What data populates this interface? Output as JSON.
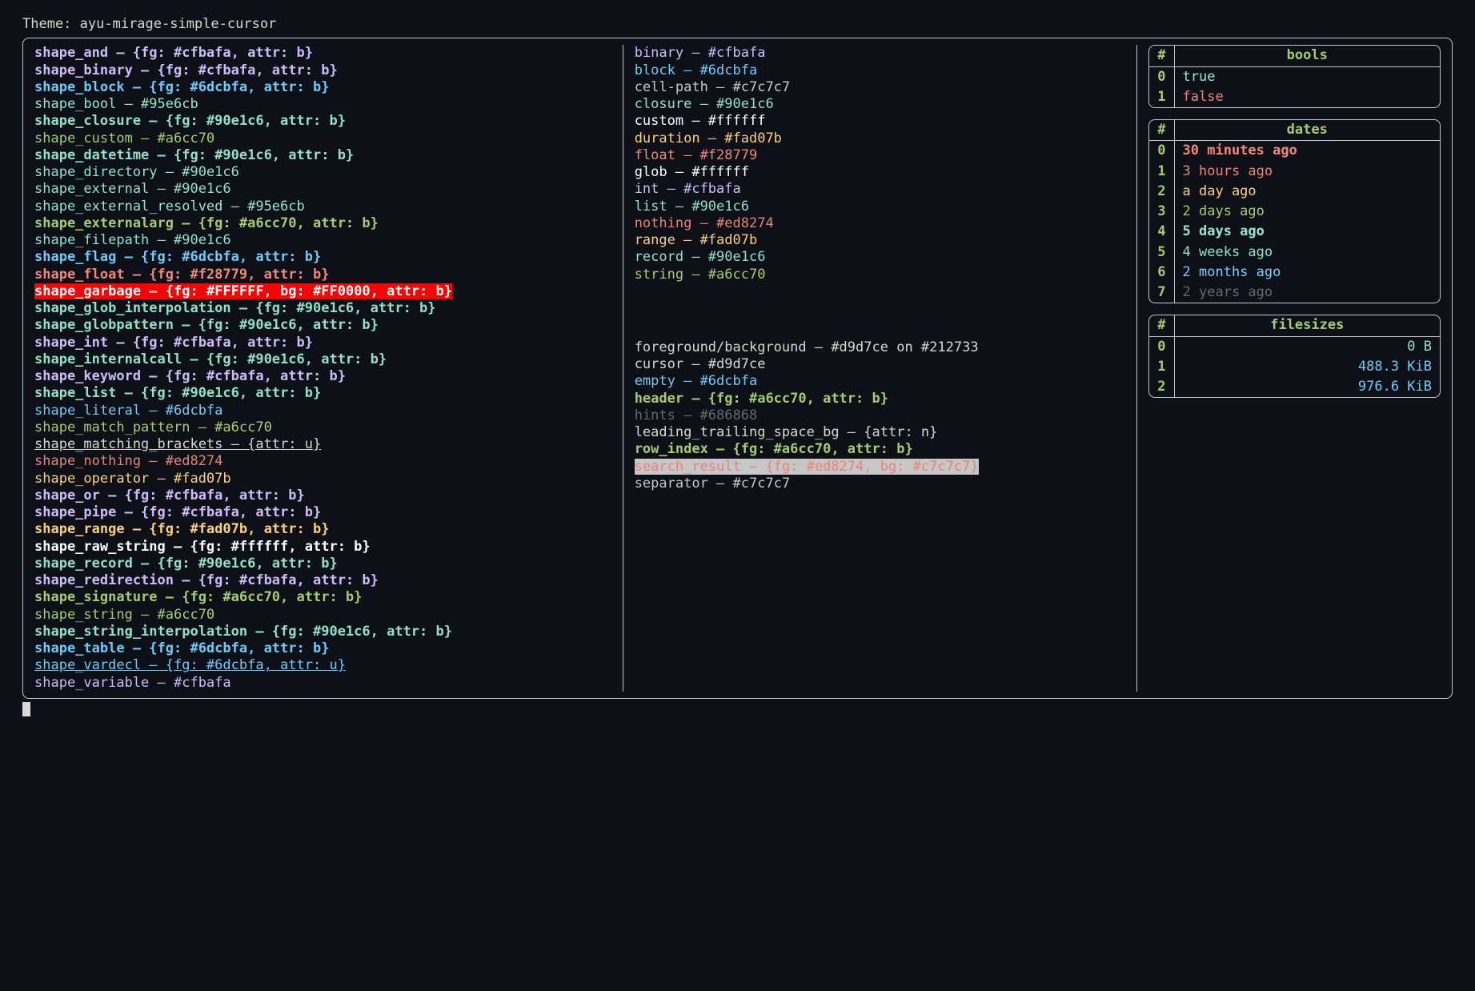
{
  "header": {
    "label": "Theme: ",
    "value": "ayu-mirage-simple-cursor"
  },
  "palette": {
    "fg": "#d9d7ce",
    "bg": "#212733",
    "cfbafa": "#cfbafa",
    "6dcbfa": "#6dcbfa",
    "95e6cb": "#95e6cb",
    "90e1c6": "#90e1c6",
    "a6cc70": "#a6cc70",
    "f28779": "#f28779",
    "fad07b": "#fad07b",
    "ed8274": "#ed8274",
    "c7c7c7": "#c7c7c7",
    "686868": "#686868",
    "ffffff": "#ffffff",
    "73d0ff": "#73d0ff"
  },
  "shapes": [
    {
      "name": "shape_and",
      "fg": "cfbafa",
      "bold": true,
      "text": "{fg: #cfbafa, attr: b}"
    },
    {
      "name": "shape_binary",
      "fg": "cfbafa",
      "bold": true,
      "text": "{fg: #cfbafa, attr: b}"
    },
    {
      "name": "shape_block",
      "fg": "6dcbfa",
      "bold": true,
      "text": "{fg: #6dcbfa, attr: b}"
    },
    {
      "name": "shape_bool",
      "fg": "95e6cb",
      "text": "#95e6cb"
    },
    {
      "name": "shape_closure",
      "fg": "90e1c6",
      "bold": true,
      "text": "{fg: #90e1c6, attr: b}"
    },
    {
      "name": "shape_custom",
      "fg": "a6cc70",
      "text": "#a6cc70"
    },
    {
      "name": "shape_datetime",
      "fg": "90e1c6",
      "bold": true,
      "text": "{fg: #90e1c6, attr: b}"
    },
    {
      "name": "shape_directory",
      "fg": "90e1c6",
      "text": "#90e1c6"
    },
    {
      "name": "shape_external",
      "fg": "90e1c6",
      "text": "#90e1c6"
    },
    {
      "name": "shape_external_resolved",
      "fg": "95e6cb",
      "text": "#95e6cb"
    },
    {
      "name": "shape_externalarg",
      "fg": "a6cc70",
      "bold": true,
      "text": "{fg: #a6cc70, attr: b}"
    },
    {
      "name": "shape_filepath",
      "fg": "90e1c6",
      "text": "#90e1c6"
    },
    {
      "name": "shape_flag",
      "fg": "6dcbfa",
      "bold": true,
      "text": "{fg: #6dcbfa, attr: b}"
    },
    {
      "name": "shape_float",
      "fg": "f28779",
      "bold": true,
      "text": "{fg: #f28779, attr: b}"
    },
    {
      "name": "shape_garbage",
      "special": "garbage",
      "text": "{fg: #FFFFFF, bg: #FF0000, attr: b}"
    },
    {
      "name": "shape_glob_interpolation",
      "fg": "90e1c6",
      "bold": true,
      "text": "{fg: #90e1c6, attr: b}"
    },
    {
      "name": "shape_globpattern",
      "fg": "90e1c6",
      "bold": true,
      "text": "{fg: #90e1c6, attr: b}"
    },
    {
      "name": "shape_int",
      "fg": "cfbafa",
      "bold": true,
      "text": "{fg: #cfbafa, attr: b}"
    },
    {
      "name": "shape_internalcall",
      "fg": "90e1c6",
      "bold": true,
      "text": "{fg: #90e1c6, attr: b}"
    },
    {
      "name": "shape_keyword",
      "fg": "cfbafa",
      "bold": true,
      "text": "{fg: #cfbafa, attr: b}"
    },
    {
      "name": "shape_list",
      "fg": "90e1c6",
      "bold": true,
      "text": "{fg: #90e1c6, attr: b}"
    },
    {
      "name": "shape_literal",
      "fg": "6dcbfa",
      "text": "#6dcbfa"
    },
    {
      "name": "shape_match_pattern",
      "fg": "a6cc70",
      "text": "#a6cc70"
    },
    {
      "name": "shape_matching_brackets",
      "fg": "fg",
      "underline": true,
      "text": "{attr: u}"
    },
    {
      "name": "shape_nothing",
      "fg": "ed8274",
      "text": "#ed8274"
    },
    {
      "name": "shape_operator",
      "fg": "fad07b",
      "text": "#fad07b"
    },
    {
      "name": "shape_or",
      "fg": "cfbafa",
      "bold": true,
      "text": "{fg: #cfbafa, attr: b}"
    },
    {
      "name": "shape_pipe",
      "fg": "cfbafa",
      "bold": true,
      "text": "{fg: #cfbafa, attr: b}"
    },
    {
      "name": "shape_range",
      "fg": "fad07b",
      "bold": true,
      "text": "{fg: #fad07b, attr: b}"
    },
    {
      "name": "shape_raw_string",
      "fg": "ffffff",
      "bold": true,
      "text": "{fg: #ffffff, attr: b}"
    },
    {
      "name": "shape_record",
      "fg": "90e1c6",
      "bold": true,
      "text": "{fg: #90e1c6, attr: b}"
    },
    {
      "name": "shape_redirection",
      "fg": "cfbafa",
      "bold": true,
      "text": "{fg: #cfbafa, attr: b}"
    },
    {
      "name": "shape_signature",
      "fg": "a6cc70",
      "bold": true,
      "text": "{fg: #a6cc70, attr: b}"
    },
    {
      "name": "shape_string",
      "fg": "a6cc70",
      "text": "#a6cc70"
    },
    {
      "name": "shape_string_interpolation",
      "fg": "90e1c6",
      "bold": true,
      "text": "{fg: #90e1c6, attr: b}"
    },
    {
      "name": "shape_table",
      "fg": "6dcbfa",
      "bold": true,
      "text": "{fg: #6dcbfa, attr: b}"
    },
    {
      "name": "shape_vardecl",
      "fg": "6dcbfa",
      "underline": true,
      "text": "{fg: #6dcbfa, attr: u}"
    },
    {
      "name": "shape_variable",
      "fg": "cfbafa",
      "text": "#cfbafa"
    }
  ],
  "types": [
    {
      "name": "binary",
      "fg": "cfbafa",
      "text": "#cfbafa"
    },
    {
      "name": "block",
      "fg": "6dcbfa",
      "text": "#6dcbfa"
    },
    {
      "name": "cell-path",
      "fg": "c7c7c7",
      "text": "#c7c7c7"
    },
    {
      "name": "closure",
      "fg": "90e1c6",
      "text": "#90e1c6"
    },
    {
      "name": "custom",
      "fg": "ffffff",
      "text": "#ffffff"
    },
    {
      "name": "duration",
      "fg": "fad07b",
      "text": "#fad07b"
    },
    {
      "name": "float",
      "fg": "f28779",
      "text": "#f28779"
    },
    {
      "name": "glob",
      "fg": "ffffff",
      "text": "#ffffff"
    },
    {
      "name": "int",
      "fg": "cfbafa",
      "text": "#cfbafa"
    },
    {
      "name": "list",
      "fg": "90e1c6",
      "text": "#90e1c6"
    },
    {
      "name": "nothing",
      "fg": "ed8274",
      "text": "#ed8274"
    },
    {
      "name": "range",
      "fg": "fad07b",
      "text": "#fad07b"
    },
    {
      "name": "record",
      "fg": "90e1c6",
      "text": "#90e1c6"
    },
    {
      "name": "string",
      "fg": "a6cc70",
      "text": "#a6cc70"
    }
  ],
  "misc": [
    {
      "name": "foreground/background",
      "fg": "fg",
      "text": "#d9d7ce on #212733"
    },
    {
      "name": "cursor",
      "fg": "fg",
      "text": "#d9d7ce"
    },
    {
      "name": "empty",
      "fg": "6dcbfa",
      "text": "#6dcbfa"
    },
    {
      "name": "header",
      "fg": "a6cc70",
      "bold": true,
      "text": "{fg: #a6cc70, attr: b}"
    },
    {
      "name": "hints",
      "fg": "686868",
      "text": "#686868"
    },
    {
      "name": "leading_trailing_space_bg",
      "fg": "fg",
      "text": "{attr: n}"
    },
    {
      "name": "row_index",
      "fg": "a6cc70",
      "bold": true,
      "text": "{fg: #a6cc70, attr: b}"
    },
    {
      "name": "search_result",
      "special": "search",
      "text": "{fg: #ed8274, bg: #c7c7c7}"
    },
    {
      "name": "separator",
      "fg": "c7c7c7",
      "text": "#c7c7c7"
    }
  ],
  "tables": {
    "bools": {
      "head": [
        "#",
        "bools"
      ],
      "rows": [
        {
          "i": "0",
          "v": "true",
          "c": "95e6cb"
        },
        {
          "i": "1",
          "v": "false",
          "c": "ed8274"
        }
      ]
    },
    "dates": {
      "head": [
        "#",
        "dates"
      ],
      "rows": [
        {
          "i": "0",
          "v": "30 minutes ago",
          "c": "f28779",
          "b": true
        },
        {
          "i": "1",
          "v": "3 hours ago",
          "c": "ed8274"
        },
        {
          "i": "2",
          "v": "a day ago",
          "c": "fad07b"
        },
        {
          "i": "3",
          "v": "2 days ago",
          "c": "a6cc70"
        },
        {
          "i": "4",
          "v": "5 days ago",
          "c": "95e6cb",
          "b": true
        },
        {
          "i": "5",
          "v": "4 weeks ago",
          "c": "90e1c6"
        },
        {
          "i": "6",
          "v": "2 months ago",
          "c": "73d0ff"
        },
        {
          "i": "7",
          "v": "2 years ago",
          "c": "686868"
        }
      ]
    },
    "filesizes": {
      "head": [
        "#",
        "filesizes"
      ],
      "rows": [
        {
          "i": "0",
          "v": "0 B",
          "c": "90e1c6"
        },
        {
          "i": "1",
          "v": "488.3 KiB",
          "c": "6dcbfa"
        },
        {
          "i": "2",
          "v": "976.6 KiB",
          "c": "6dcbfa"
        }
      ]
    }
  }
}
